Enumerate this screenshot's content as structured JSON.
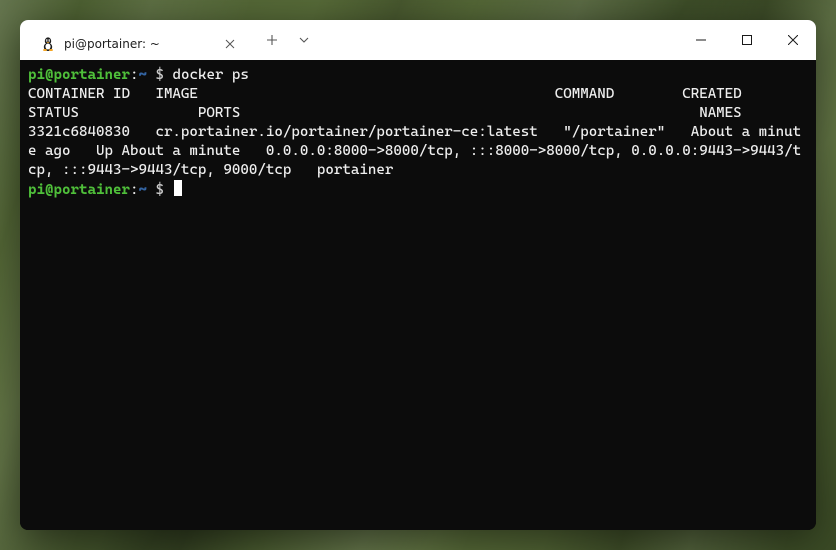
{
  "tab": {
    "icon": "tux-icon",
    "title": "pi@portainer: ~"
  },
  "prompt": {
    "user_host": "pi@portainer",
    "colon": ":",
    "path": "~",
    "symbol": " $ "
  },
  "command": "docker ps",
  "output_header": "CONTAINER ID   IMAGE                                          COMMAND        CREATED              STATUS              PORTS                                                      NAMES",
  "output_row": "3321c6840830   cr.portainer.io/portainer/portainer-ce:latest   \"/portainer\"   About a minute ago   Up About a minute   0.0.0.0:8000->8000/tcp, :::8000->8000/tcp, 0.0.0.0:9443->9443/tcp, :::9443->9443/tcp, 9000/tcp   portainer"
}
